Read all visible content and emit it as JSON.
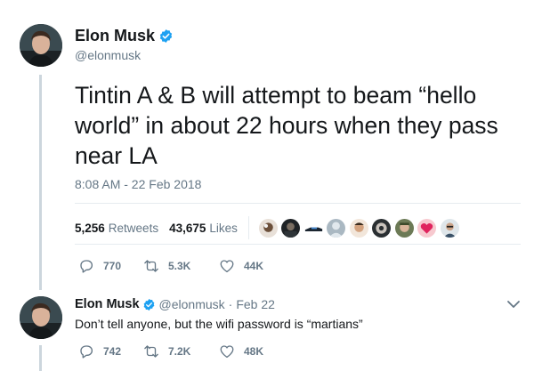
{
  "tweet": {
    "display_name": "Elon Musk",
    "handle": "@elonmusk",
    "text": "Tintin A & B will attempt to beam “hello world” in about 22 hours when they pass near LA",
    "timestamp": "8:08 AM - 22 Feb 2018",
    "retweets_count": "5,256",
    "retweets_label": "Retweets",
    "likes_count": "43,675",
    "likes_label": "Likes",
    "reply_count": "770",
    "retweet_count_short": "5.3K",
    "like_count_short": "44K"
  },
  "reply": {
    "display_name": "Elon Musk",
    "handle": "@elonmusk",
    "separator": "·",
    "date": "Feb 22",
    "text": "Don’t tell anyone, but the wifi password is “martians”",
    "reply_count": "742",
    "retweet_count": "7.2K",
    "like_count": "48K"
  },
  "colors": {
    "verified_blue": "#1da1f2",
    "secondary_text": "#657786",
    "primary_text": "#14171a",
    "thread_line": "#ccd6dd"
  },
  "icons": [
    "verified-badge-icon",
    "reply-icon",
    "retweet-icon",
    "like-icon",
    "chevron-down-icon"
  ]
}
